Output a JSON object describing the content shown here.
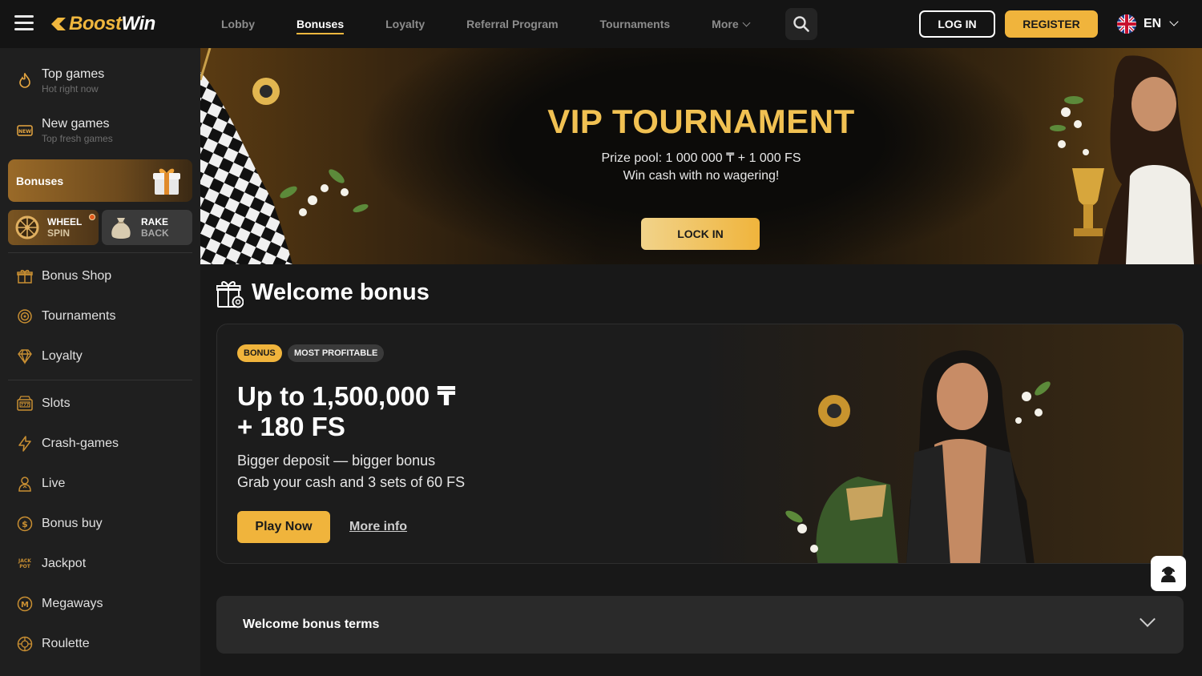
{
  "header": {
    "logo_boost": "Boost",
    "logo_win": "Win",
    "nav": [
      {
        "label": "Lobby",
        "active": false
      },
      {
        "label": "Bonuses",
        "active": true
      },
      {
        "label": "Loyalty",
        "active": false
      },
      {
        "label": "Referral Program",
        "active": false
      },
      {
        "label": "Tournaments",
        "active": false
      },
      {
        "label": "More",
        "active": false
      }
    ],
    "login_label": "LOG IN",
    "register_label": "REGISTER",
    "language": "EN"
  },
  "sidebar": {
    "top_items": [
      {
        "title": "Top games",
        "subtitle": "Hot right now",
        "icon": "flame-icon"
      },
      {
        "title": "New games",
        "subtitle": "Top fresh games",
        "icon": "new-icon"
      }
    ],
    "bonuses_label": "Bonuses",
    "wheel": {
      "line1": "WHEEL",
      "line2": "SPIN"
    },
    "rake": {
      "line1": "RAKE",
      "line2": "BACK"
    },
    "group1": [
      {
        "label": "Bonus Shop",
        "icon": "gift-icon"
      },
      {
        "label": "Tournaments",
        "icon": "target-icon"
      },
      {
        "label": "Loyalty",
        "icon": "diamond-icon"
      }
    ],
    "group2": [
      {
        "label": "Slots",
        "icon": "slots-icon"
      },
      {
        "label": "Crash-games",
        "icon": "lightning-icon"
      },
      {
        "label": "Live",
        "icon": "dealer-icon"
      },
      {
        "label": "Bonus buy",
        "icon": "dollar-icon"
      },
      {
        "label": "Jackpot",
        "icon": "jackpot-icon"
      },
      {
        "label": "Megaways",
        "icon": "megaways-icon"
      },
      {
        "label": "Roulette",
        "icon": "roulette-icon"
      }
    ]
  },
  "banner": {
    "title": "VIP TOURNAMENT",
    "line1": "Prize pool: 1 000 000 ₸ + 1 000 FS",
    "line2": "Win cash with no wagering!",
    "button": "LOCK IN"
  },
  "welcome": {
    "section_title": "Welcome bonus",
    "badge1": "BONUS",
    "badge2": "MOST PROFITABLE",
    "offer_line1": "Up to 1,500,000 ₸",
    "offer_line2": "+ 180 FS",
    "desc1": "Bigger deposit — bigger bonus",
    "desc2": "Grab your cash and 3 sets of 60 FS",
    "play_button": "Play Now",
    "more_link": "More info",
    "terms_label": "Welcome bonus terms"
  },
  "colors": {
    "accent": "#f0b43c",
    "background": "#181818",
    "sidebar": "#1f1f1f"
  }
}
